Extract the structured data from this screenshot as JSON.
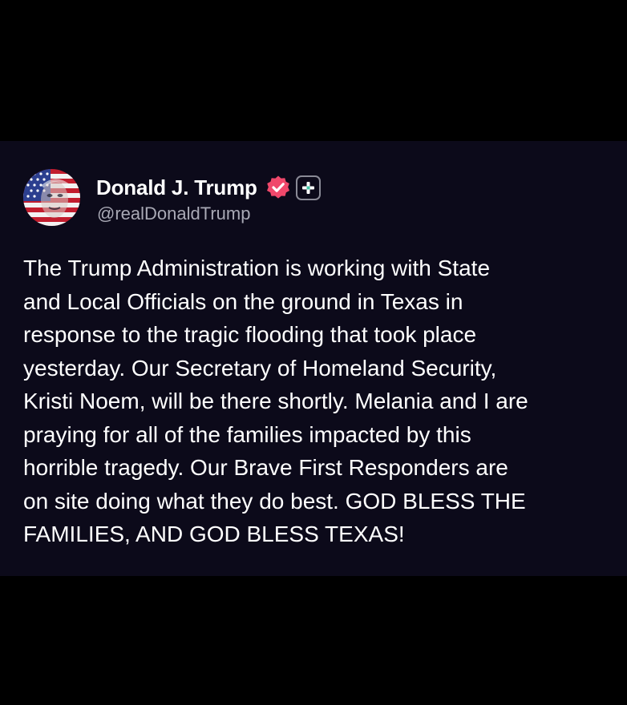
{
  "post": {
    "author": {
      "display_name": "Donald J. Trump",
      "handle": "@realDonaldTrump",
      "avatar_icon": "avatar-flag-portrait",
      "verified_icon": "verified-badge-icon",
      "plus_icon": "plus-badge-icon"
    },
    "text": "The Trump Administration is working with State\nand Local Officials on the ground in Texas in\nresponse to the tragic flooding that took place\nyesterday. Our Secretary of Homeland Security,\nKristi Noem, will be there shortly. Melania and I are\npraying for all of the families impacted by this\nhorrible tragedy. Our Brave First Responders are\non site doing what they do best. GOD BLESS THE\nFAMILIES, AND GOD BLESS TEXAS!"
  },
  "colors": {
    "background": "#000000",
    "card": "#0c0a1a",
    "text": "#ffffff",
    "handle": "#a9a9b5",
    "verified": "#f0486b"
  }
}
